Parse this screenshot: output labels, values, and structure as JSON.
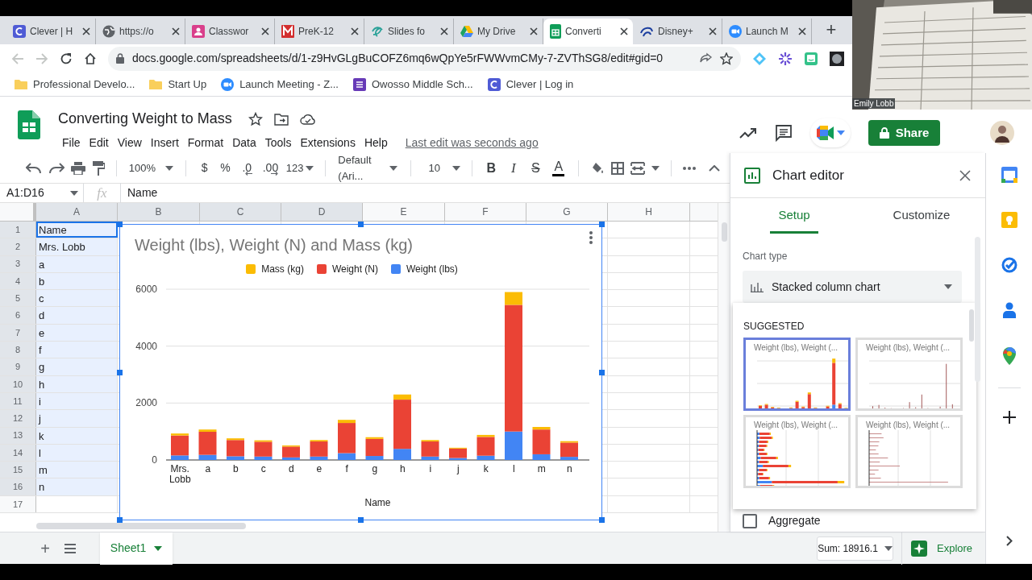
{
  "browser": {
    "tabs": [
      {
        "title": "Clever | H",
        "selected": false
      },
      {
        "title": "https://o",
        "selected": false
      },
      {
        "title": "Classwor",
        "selected": false
      },
      {
        "title": "PreK-12",
        "selected": false
      },
      {
        "title": "Slides fo",
        "selected": false
      },
      {
        "title": "My Drive",
        "selected": false
      },
      {
        "title": "Converti",
        "selected": true
      },
      {
        "title": "Disney+",
        "selected": false
      },
      {
        "title": "Launch M",
        "selected": false
      }
    ],
    "new_tab": "+",
    "url": "docs.google.com/spreadsheets/d/1-z9HvGLgBuCOFZ6mq6wQpYe5rFWWvmCMy-7-ZVThSG8/edit#gid=0",
    "bookmarks": [
      {
        "label": "Professional Develo...",
        "kind": "folder"
      },
      {
        "label": "Start Up",
        "kind": "folder"
      },
      {
        "label": "Launch Meeting - Z...",
        "kind": "video"
      },
      {
        "label": "Owosso Middle Sch...",
        "kind": "list"
      },
      {
        "label": "Clever | Log in",
        "kind": "clever"
      }
    ]
  },
  "doc": {
    "title": "Converting Weight to Mass",
    "menu": [
      "File",
      "Edit",
      "View",
      "Insert",
      "Format",
      "Data",
      "Tools",
      "Extensions",
      "Help"
    ],
    "last_edit": "Last edit was seconds ago",
    "share": "Share"
  },
  "toolbar": {
    "zoom": "100%",
    "currency": "$",
    "percent": "%",
    "decrease_decimals": ".0",
    "increase_decimals": ".00",
    "more_formats": "123",
    "font": "Default (Ari...",
    "font_size": "10",
    "bold": "B",
    "italic": "I",
    "strikethrough": "S",
    "text_color": "A"
  },
  "formula_bar": {
    "name_box": "A1:D16",
    "fx": "fx",
    "value": "Name"
  },
  "sheet": {
    "columns": [
      {
        "label": "A",
        "selected": true
      },
      {
        "label": "B",
        "selected": true
      },
      {
        "label": "C",
        "selected": true
      },
      {
        "label": "D",
        "selected": true
      },
      {
        "label": "E",
        "selected": false
      },
      {
        "label": "F",
        "selected": false
      },
      {
        "label": "G",
        "selected": false
      },
      {
        "label": "H",
        "selected": false
      }
    ],
    "rows": [
      {
        "number": "1",
        "a": "Name",
        "selected": true
      },
      {
        "number": "2",
        "a": "Mrs. Lobb",
        "selected": true
      },
      {
        "number": "3",
        "a": "a",
        "selected": true
      },
      {
        "number": "4",
        "a": "b",
        "selected": true
      },
      {
        "number": "5",
        "a": "c",
        "selected": true
      },
      {
        "number": "6",
        "a": "d",
        "selected": true
      },
      {
        "number": "7",
        "a": "e",
        "selected": true
      },
      {
        "number": "8",
        "a": "f",
        "selected": true
      },
      {
        "number": "9",
        "a": "g",
        "selected": true
      },
      {
        "number": "10",
        "a": "h",
        "selected": true
      },
      {
        "number": "11",
        "a": "i",
        "selected": true
      },
      {
        "number": "12",
        "a": "j",
        "selected": true
      },
      {
        "number": "13",
        "a": "k",
        "selected": true
      },
      {
        "number": "14",
        "a": "l",
        "selected": true
      },
      {
        "number": "15",
        "a": "m",
        "selected": true
      },
      {
        "number": "16",
        "a": "n",
        "selected": true
      },
      {
        "number": "17",
        "selected": false
      }
    ]
  },
  "chart": {
    "chart_data": {
      "type": "bar",
      "stacked": true,
      "title": "Weight (lbs), Weight (N) and Mass (kg)",
      "xlabel": "Name",
      "categories": [
        "Mrs. Lobb",
        "a",
        "b",
        "c",
        "d",
        "e",
        "f",
        "g",
        "h",
        "i",
        "j",
        "k",
        "l",
        "m",
        "n"
      ],
      "series": [
        {
          "name": "Weight (lbs)",
          "color": "#4285f4",
          "values": [
            160,
            180,
            130,
            120,
            90,
            120,
            240,
            140,
            390,
            120,
            70,
            150,
            1000,
            200,
            110
          ]
        },
        {
          "name": "Weight (N)",
          "color": "#ea4335",
          "values": [
            700,
            810,
            570,
            520,
            380,
            530,
            1060,
            600,
            1730,
            530,
            330,
            660,
            4450,
            870,
            500
          ]
        },
        {
          "name": "Mass (kg)",
          "color": "#fbbc04",
          "values": [
            70,
            80,
            60,
            50,
            40,
            50,
            110,
            60,
            180,
            50,
            30,
            70,
            450,
            90,
            50
          ]
        }
      ],
      "legend": "top",
      "ylim": [
        0,
        6000
      ],
      "yticks": [
        0,
        2000,
        4000,
        6000
      ]
    }
  },
  "chart_editor": {
    "title": "Chart editor",
    "tabs": [
      {
        "label": "Setup",
        "selected": true
      },
      {
        "label": "Customize",
        "selected": false
      }
    ],
    "chart_type_label": "Chart type",
    "chart_type": "Stacked column chart",
    "suggested_heading": "SUGGESTED",
    "suggestions": [
      {
        "title": "Weight (lbs), Weight (...",
        "kind": "stacked-column",
        "selected": true
      },
      {
        "title": "Weight (lbs), Weight (...",
        "kind": "column",
        "selected": false
      },
      {
        "title": "Weight (lbs), Weight (...",
        "kind": "stacked-bar",
        "selected": false
      },
      {
        "title": "Weight (lbs), Weight (...",
        "kind": "bar",
        "selected": false
      }
    ],
    "aggregate": {
      "label": "Aggregate",
      "checked": false
    }
  },
  "bottom_bar": {
    "add": "+",
    "sheets": [
      {
        "name": "Sheet1",
        "selected": true
      }
    ],
    "sum": "Sum: 18916.1",
    "explore": "Explore"
  },
  "video": {
    "name": "Emily Lobb"
  }
}
